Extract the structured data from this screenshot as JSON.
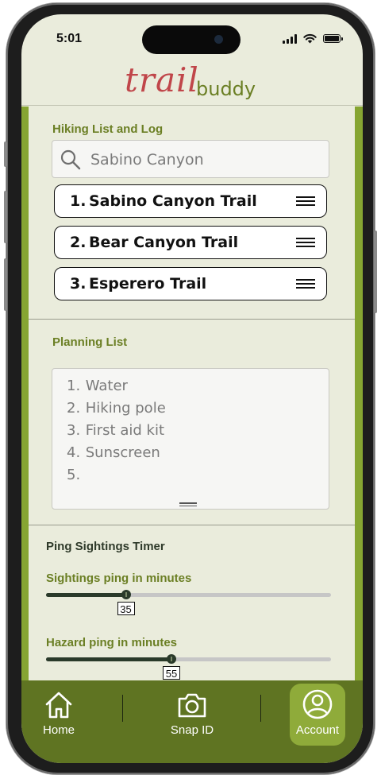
{
  "status_bar": {
    "time": "5:01"
  },
  "logo": {
    "part1": "trail",
    "part2": "buddy"
  },
  "hiking": {
    "title": "Hiking List and Log",
    "search_value": "Sabino Canyon",
    "trails": [
      {
        "num": "1.",
        "name": "Sabino Canyon Trail"
      },
      {
        "num": "2.",
        "name": "Bear Canyon Trail"
      },
      {
        "num": "3.",
        "name": "Esperero Trail"
      }
    ]
  },
  "planning": {
    "title": "Planning List",
    "items": [
      {
        "num": "1.",
        "text": "Water"
      },
      {
        "num": "2.",
        "text": "Hiking pole"
      },
      {
        "num": "3.",
        "text": "First aid kit"
      },
      {
        "num": "4.",
        "text": "Sunscreen"
      },
      {
        "num": "5.",
        "text": ""
      }
    ]
  },
  "ping_timer": {
    "title": "Ping Sightings Timer",
    "sightings": {
      "label": "Sightings ping in minutes",
      "value": "35",
      "fraction": 0.28
    },
    "hazard": {
      "label": "Hazard ping in minutes",
      "value": "55",
      "fraction": 0.44
    }
  },
  "nav": {
    "items": [
      {
        "label": "Home",
        "icon": "home-icon"
      },
      {
        "label": "Snap ID",
        "icon": "camera-icon"
      },
      {
        "label": "Account",
        "icon": "account-icon",
        "active": true
      }
    ]
  },
  "colors": {
    "accent_green": "#86a532",
    "nav_green": "#5f7422",
    "active_green": "#8fab3a",
    "logo_red": "#c0464a",
    "background": "#eaecdc"
  }
}
